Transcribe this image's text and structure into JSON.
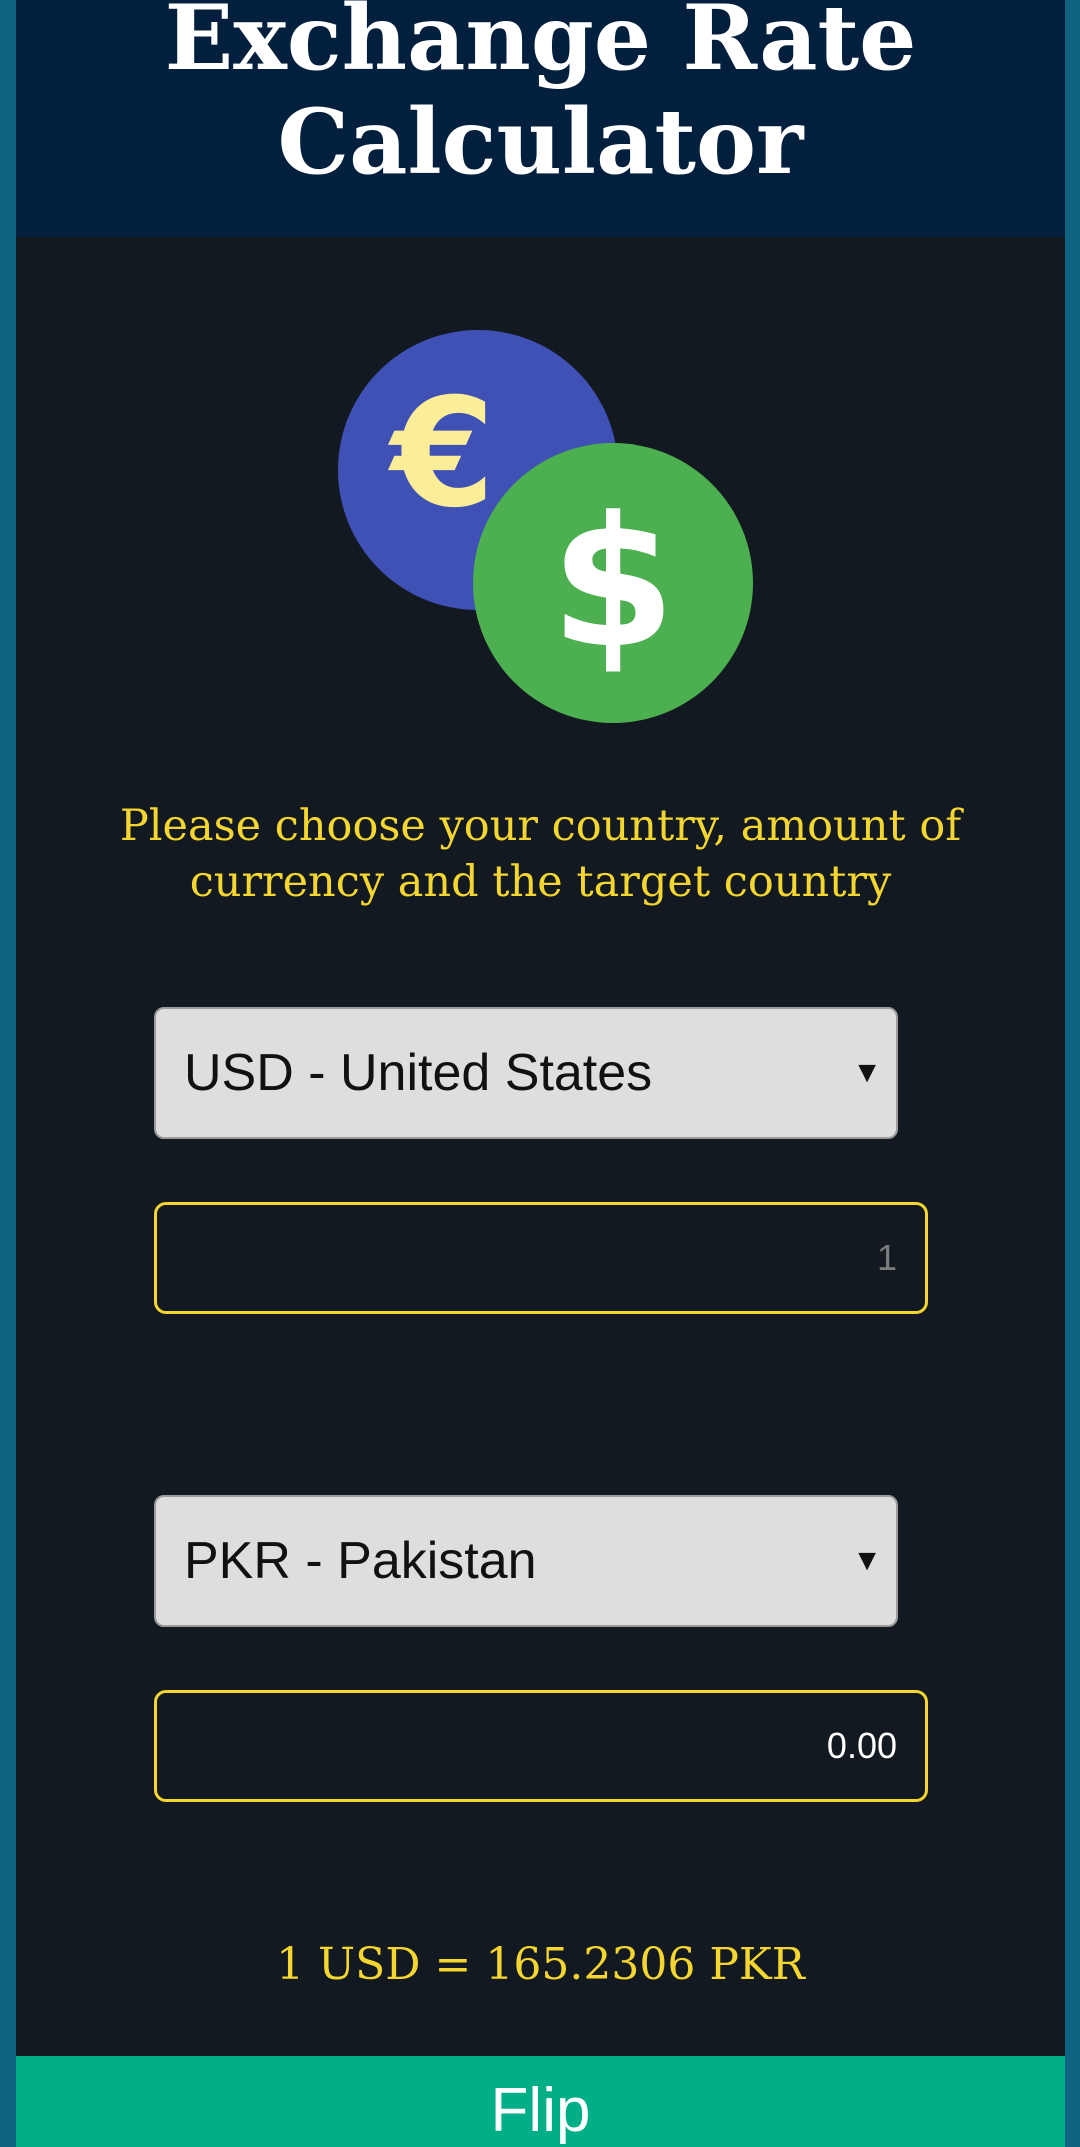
{
  "header": {
    "title": "Exchange Rate Calculator"
  },
  "logo": {
    "euro_symbol": "€",
    "dollar_symbol": "$",
    "colors": {
      "euro_coin": "#3f51b5",
      "euro_symbol": "#fcee98",
      "dollar_coin": "#4caf50",
      "dollar_symbol": "#ffffff"
    }
  },
  "instructions": "Please choose your country, amount of currency and the target country",
  "from_currency": {
    "selected": "USD - United States",
    "amount": "1"
  },
  "to_currency": {
    "selected": "PKR - Pakistan",
    "amount": "0.00"
  },
  "rate_text": "1 USD = 165.2306 PKR",
  "flip_label": "Flip",
  "colors": {
    "header_bg": "#02203d",
    "page_bg": "#121920",
    "accent_yellow": "#f5d630",
    "flip_button": "#00ae88",
    "outer_frame": "#0f6482"
  }
}
